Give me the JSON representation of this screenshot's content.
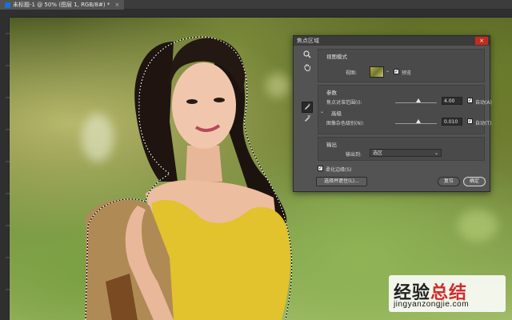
{
  "document_tab": {
    "title": "未标题-1 @ 50% (图层 1, RGB/8#) *",
    "close": "×"
  },
  "dialog": {
    "title": "焦点区域",
    "close_glyph": "×",
    "view_mode": {
      "heading": "视图模式",
      "view_label": "视图:",
      "preview_label": "预览",
      "preview_checked": true
    },
    "parameters": {
      "heading": "参数",
      "focus_range_label": "焦点对准范围(I):",
      "focus_range_value": "4.00",
      "focus_range_slider": 0.5,
      "focus_auto_label": "自动(A)",
      "focus_auto_checked": true
    },
    "advanced": {
      "heading": "高级",
      "noise_label": "图像杂色级别(N):",
      "noise_value": "0.010",
      "noise_slider": 0.5,
      "noise_auto_label": "自动(T)",
      "noise_auto_checked": true
    },
    "output": {
      "heading": "输出",
      "output_to_label": "输出到:",
      "output_to_value": "选区"
    },
    "soften_edge_label": "柔化边缘(S)",
    "soften_edge_checked": true,
    "select_and_mask_button": "选择并遮住(L)...",
    "reset_button": "复位",
    "ok_button": "确定"
  },
  "watermark": {
    "cn_black": "经验",
    "cn_red": "总结",
    "url": "jingyanzongjie.com"
  },
  "colors": {
    "ui_dark": "#535353",
    "close_red": "#c42b1c",
    "shirt_yellow": "#e2c22d",
    "watermark_red": "#d42a2a"
  }
}
